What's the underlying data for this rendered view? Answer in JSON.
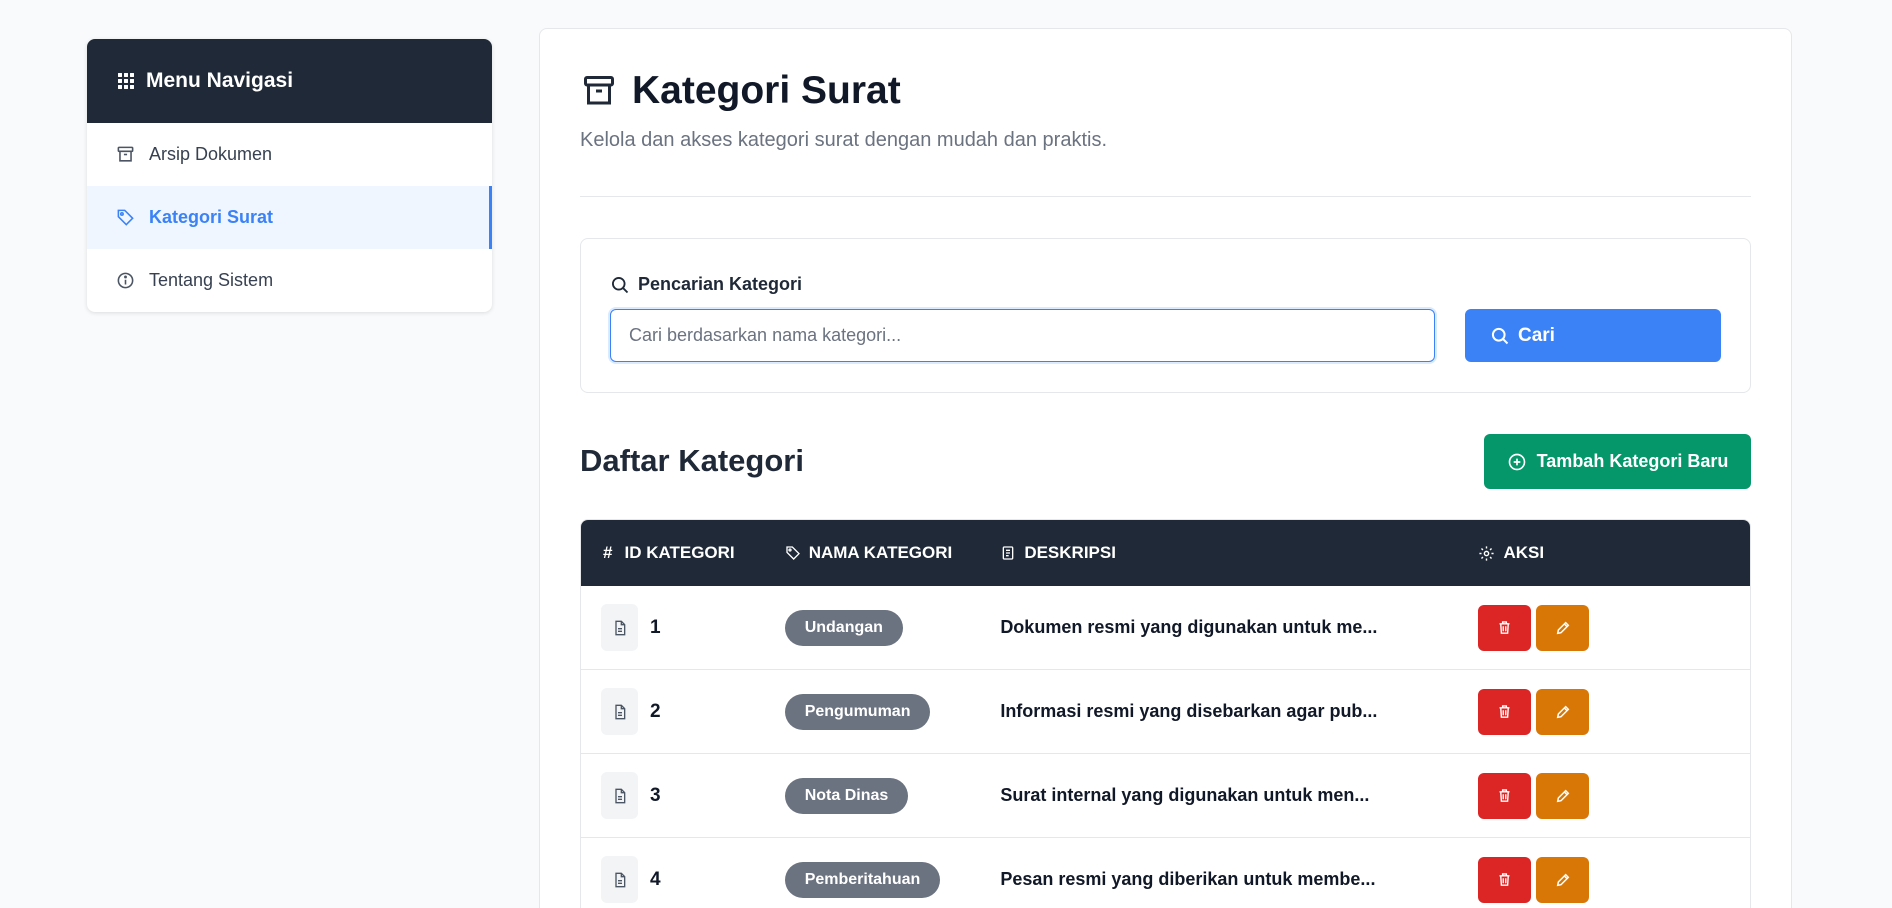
{
  "sidebar": {
    "title": "Menu Navigasi",
    "items": [
      {
        "label": "Arsip Dokumen",
        "icon": "archive-icon",
        "active": false
      },
      {
        "label": "Kategori Surat",
        "icon": "tag-icon",
        "active": true
      },
      {
        "label": "Tentang Sistem",
        "icon": "info-icon",
        "active": false
      }
    ]
  },
  "header": {
    "title": "Kategori Surat",
    "subtitle": "Kelola dan akses kategori surat dengan mudah dan praktis."
  },
  "search": {
    "label": "Pencarian Kategori",
    "placeholder": "Cari berdasarkan nama kategori...",
    "value": "",
    "button_label": "Cari"
  },
  "list": {
    "title": "Daftar Kategori",
    "add_button_label": "Tambah Kategori Baru"
  },
  "table": {
    "columns": [
      {
        "label": "ID KATEGORI",
        "icon": "hash-icon"
      },
      {
        "label": "NAMA KATEGORI",
        "icon": "tag-icon"
      },
      {
        "label": "DESKRIPSI",
        "icon": "document-icon"
      },
      {
        "label": "AKSI",
        "icon": "gear-icon"
      }
    ],
    "rows": [
      {
        "id": "1",
        "name": "Undangan",
        "description": "Dokumen resmi yang digunakan untuk me..."
      },
      {
        "id": "2",
        "name": "Pengumuman",
        "description": "Informasi resmi yang disebarkan agar pub..."
      },
      {
        "id": "3",
        "name": "Nota Dinas",
        "description": "Surat internal yang digunakan untuk men..."
      },
      {
        "id": "4",
        "name": "Pemberitahuan",
        "description": "Pesan resmi yang diberikan untuk membe..."
      }
    ]
  },
  "colors": {
    "sidebar_header": "#1f2937",
    "accent": "#3b82f6",
    "success": "#059669",
    "danger": "#dc2626",
    "warning": "#d97706",
    "badge": "#6b7280"
  }
}
